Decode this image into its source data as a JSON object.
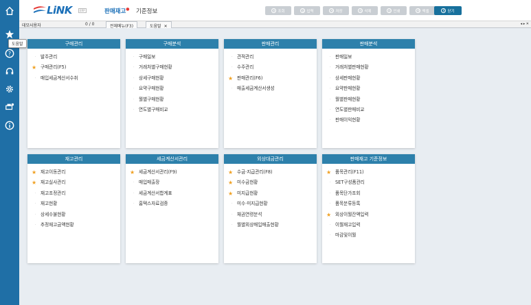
{
  "rail": {
    "icons": [
      "home-icon",
      "star-icon",
      "help-icon",
      "headset-icon",
      "gear-icon",
      "printer-settings-icon",
      "info-icon"
    ],
    "tooltip": "도움말"
  },
  "header": {
    "brand": "LiNK",
    "erp": "ERP",
    "title": "판매재고",
    "subtitle": "기준정보",
    "toolbar": [
      {
        "icon": "조",
        "label": "조회"
      },
      {
        "icon": "입",
        "label": "입력"
      },
      {
        "icon": "저",
        "label": "저장"
      },
      {
        "icon": "삭",
        "label": "삭제"
      },
      {
        "icon": "인",
        "label": "인쇄"
      },
      {
        "icon": "엑",
        "label": "엑셀"
      }
    ],
    "close": {
      "icon": "X",
      "label": "닫기"
    }
  },
  "tabstrip": {
    "user": "데모사용자",
    "count": "0 / 0",
    "tabs": [
      {
        "label": "전체메뉴(F3)"
      },
      {
        "label": "도움말",
        "close": "✕"
      }
    ],
    "arrows": "◂ ▸ ✕"
  },
  "cards": [
    {
      "title": "구매관리",
      "items": [
        {
          "label": "발주관리",
          "star": false
        },
        {
          "label": "구매관리(F5)",
          "star": true
        },
        {
          "label": "매입세금계산서수취",
          "star": false
        }
      ]
    },
    {
      "title": "구매분석",
      "items": [
        {
          "label": "구매일보",
          "star": false
        },
        {
          "label": "거래처별구매현황",
          "star": false
        },
        {
          "label": "상세구매현황",
          "star": false
        },
        {
          "label": "요약구매현황",
          "star": false
        },
        {
          "label": "월별구매현황",
          "star": false
        },
        {
          "label": "연도별구매비교",
          "star": false
        }
      ]
    },
    {
      "title": "판매관리",
      "items": [
        {
          "label": "견적관리",
          "star": false
        },
        {
          "label": "수주관리",
          "star": false
        },
        {
          "label": "판매관리(F6)",
          "star": true
        },
        {
          "label": "매출세금계산서생성",
          "star": false
        }
      ]
    },
    {
      "title": "판매분석",
      "items": [
        {
          "label": "판매일보",
          "star": false
        },
        {
          "label": "거래처별판매현황",
          "star": false
        },
        {
          "label": "상세판매현황",
          "star": false
        },
        {
          "label": "요약판매현황",
          "star": false
        },
        {
          "label": "월별판매현황",
          "star": false
        },
        {
          "label": "연도별판매비교",
          "star": false
        },
        {
          "label": "판매이익현황",
          "star": false
        }
      ]
    },
    {
      "title": "재고관리",
      "items": [
        {
          "label": "재고이동관리",
          "star": true
        },
        {
          "label": "재고실사관리",
          "star": true
        },
        {
          "label": "재고조정관리",
          "star": false
        },
        {
          "label": "재고현황",
          "star": false
        },
        {
          "label": "상세수불현황",
          "star": false
        },
        {
          "label": "추정재고금액현황",
          "star": false
        }
      ]
    },
    {
      "title": "세금계산서관리",
      "items": [
        {
          "label": "세금계산서관리(F9)",
          "star": true
        },
        {
          "label": "매입매출장",
          "star": false
        },
        {
          "label": "세금계산서합계표",
          "star": false
        },
        {
          "label": "홈택스자료검증",
          "star": false
        }
      ]
    },
    {
      "title": "외상대금관리",
      "items": [
        {
          "label": "수금·지급관리(F8)",
          "star": true
        },
        {
          "label": "미수금현황",
          "star": true
        },
        {
          "label": "미지급현황",
          "star": true
        },
        {
          "label": "미수·미지급현황",
          "star": false
        },
        {
          "label": "채권연령분석",
          "star": false
        },
        {
          "label": "월별외상매입매출현황",
          "star": false
        }
      ]
    },
    {
      "title": "판매재고 기준정보",
      "items": [
        {
          "label": "품목관리(F11)",
          "star": true
        },
        {
          "label": "SET구성품관리",
          "star": false
        },
        {
          "label": "품목단가조회",
          "star": false
        },
        {
          "label": "품목분류등록",
          "star": false
        },
        {
          "label": "외상이월잔액입력",
          "star": true
        },
        {
          "label": "이월재고입력",
          "star": false
        },
        {
          "label": "마감및이월",
          "star": false
        }
      ]
    }
  ]
}
